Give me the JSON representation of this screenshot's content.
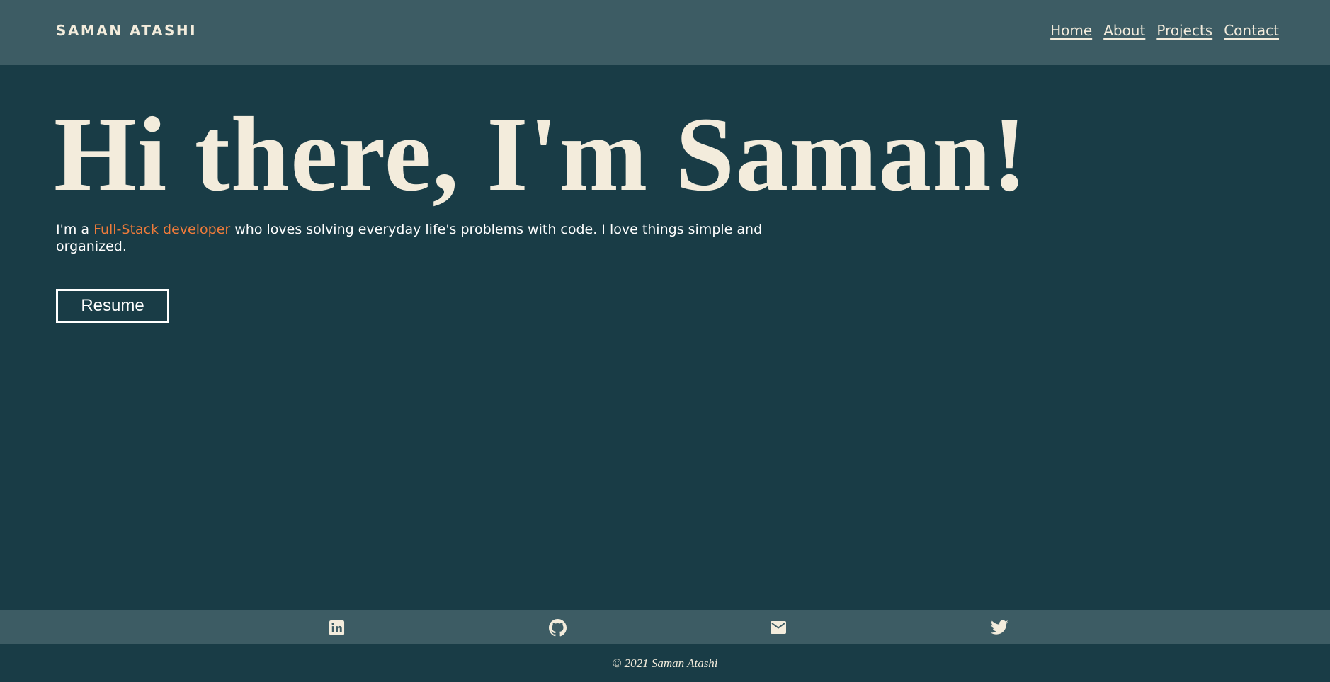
{
  "header": {
    "brand": "SAMAN ATASHI",
    "nav": [
      {
        "label": "Home"
      },
      {
        "label": "About"
      },
      {
        "label": "Projects"
      },
      {
        "label": "Contact"
      }
    ]
  },
  "hero": {
    "title": "Hi there, I'm Saman!",
    "intro_prefix": "I'm a ",
    "intro_highlight": "Full-Stack developer",
    "intro_suffix": " who loves solving everyday life's problems with code. I love things simple and organized.",
    "resume_label": "Resume"
  },
  "social": {
    "icons": [
      "linkedin-icon",
      "github-icon",
      "email-icon",
      "twitter-icon"
    ]
  },
  "footer": {
    "copyright": "© 2021 Saman Atashi"
  },
  "colors": {
    "background": "#193c46",
    "navbar": "#3d5c64",
    "cream": "#f3ecdc",
    "accent": "#ef7b3a"
  }
}
